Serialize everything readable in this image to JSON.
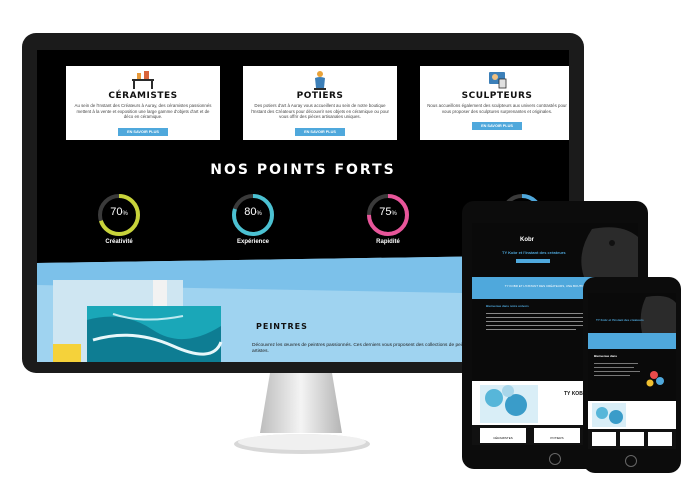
{
  "services": [
    {
      "title": "CÉRAMISTES",
      "icon": "ceramic-workbench-icon",
      "text": "Au sein de l'Instant des Créateurs à Auray, des céramistes passionnés mettent à la vente et exposition une large gamme d'objets d'art et de déco en céramique.",
      "button": "EN SAVOIR PLUS"
    },
    {
      "title": "POTIERS",
      "icon": "pottery-vase-icon",
      "text": "Des potiers d'art à Auray vous accueillent au sein de notre boutique l'Instant des Créateurs pour découvrir ses objets en céramique ou pour vous offrir des pièces artisanales uniques.",
      "button": "EN SAVOIR PLUS"
    },
    {
      "title": "SCULPTEURS",
      "icon": "sculpture-icon",
      "text": "Nous accueillons également des sculpteurs aux univers contrastés pour vous proposer des sculptures surprenantes et originales.",
      "button": "EN SAVOIR PLUS"
    }
  ],
  "points_forts": {
    "title": "NOS POINTS FORTS",
    "gauges": [
      {
        "value": "70",
        "unit": "%",
        "label": "Créativité",
        "fraction": 0.7,
        "color": "#c8d33a"
      },
      {
        "value": "80",
        "unit": "%",
        "label": "Expérience",
        "fraction": 0.8,
        "color": "#4bc1d2"
      },
      {
        "value": "75",
        "unit": "%",
        "label": "Rapidité",
        "fraction": 0.75,
        "color": "#e8559a"
      },
      {
        "value": "",
        "unit": "",
        "label": "",
        "fraction": 0.6,
        "color": "#4fa8dc"
      }
    ]
  },
  "peintres": {
    "title": "PEINTRES",
    "text": "Découvrez les œuvres de peintres passionnés. Ces derniers vous proposent des collections de peintures suivant des styles propres à chacun des artistes."
  },
  "tablet": {
    "logo": "Kobr",
    "hero": "TY Kobr et l'Instant des créateurs",
    "banner": "TY KOBR ET L'INSTANT DES CRÉATEURS, UNE BOUTIQUE D'ARTISANS",
    "section": "Bienvenue dans notre univers",
    "cards": [
      "CÉRAMISTES",
      "POTIERS",
      ""
    ],
    "side_title": "TY KOBR"
  },
  "phone": {
    "hero": "TY Kobr et l'Instant des créateurs",
    "section": "Bienvenue dans",
    "cards": [
      "",
      "",
      ""
    ]
  },
  "colors": {
    "accent": "#4fa8dc",
    "band": "#9fd3f0",
    "dark": "#000000"
  }
}
